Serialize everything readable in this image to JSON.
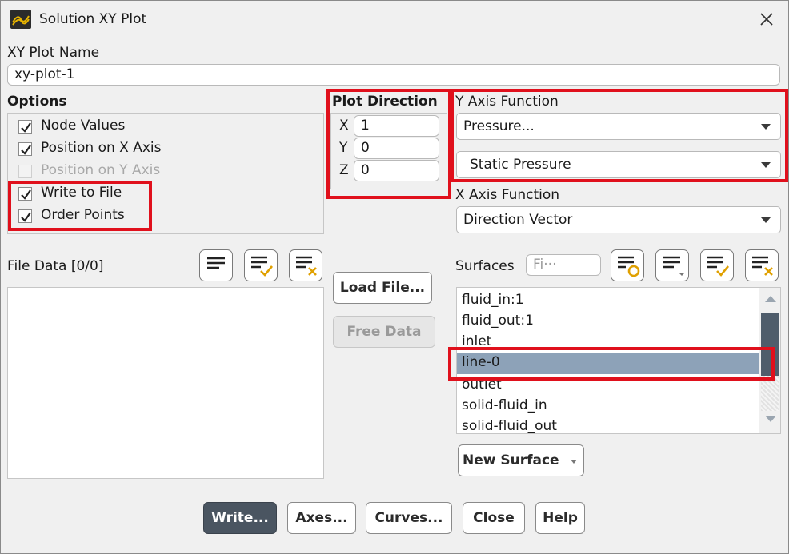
{
  "window": {
    "title": "Solution XY Plot",
    "close_glyph": "✕"
  },
  "plot_name": {
    "label": "XY Plot Name",
    "value": "xy-plot-1"
  },
  "options": {
    "label": "Options",
    "items": [
      {
        "label": "Node Values",
        "checked": true,
        "enabled": true
      },
      {
        "label": "Position on X Axis",
        "checked": true,
        "enabled": true
      },
      {
        "label": "Position on Y Axis",
        "checked": false,
        "enabled": false
      },
      {
        "label": "Write to File",
        "checked": true,
        "enabled": true
      },
      {
        "label": "Order Points",
        "checked": true,
        "enabled": true
      }
    ]
  },
  "plot_direction": {
    "label": "Plot Direction",
    "x_label": "X",
    "x_value": "1",
    "y_label": "Y",
    "y_value": "0",
    "z_label": "Z",
    "z_value": "0"
  },
  "y_axis_function": {
    "label": "Y Axis Function",
    "category": "Pressure...",
    "quantity": "Static Pressure"
  },
  "x_axis_function": {
    "label": "X Axis Function",
    "value": "Direction Vector"
  },
  "file_data": {
    "label": "File Data [0/0]"
  },
  "middle_buttons": {
    "load_file": "Load File...",
    "free_data": "Free Data"
  },
  "surfaces": {
    "label": "Surfaces",
    "filter_placeholder": "Fi···",
    "items": [
      "fluid_in:1",
      "fluid_out:1",
      "inlet",
      "line-0",
      "outlet",
      "solid-fluid_in",
      "solid-fluid_out"
    ],
    "selected": "line-0",
    "new_surface": "New Surface"
  },
  "bottom_buttons": {
    "write": "Write...",
    "axes": "Axes...",
    "curves": "Curves...",
    "close": "Close",
    "help": "Help"
  },
  "colors": {
    "highlight": "#e0101c",
    "selection": "#8da2b8",
    "primary_button": "#4a5561"
  }
}
